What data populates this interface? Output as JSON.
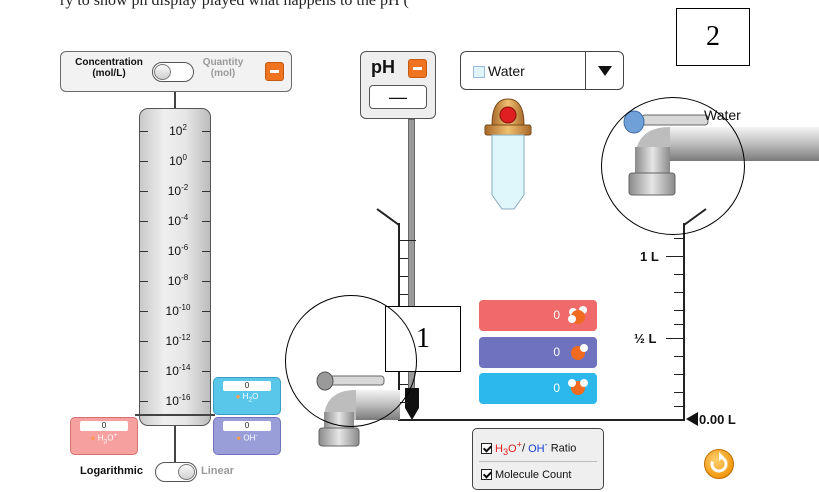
{
  "top_text": "ry to show ph display played what happens to the pH (",
  "callouts": {
    "one": "1",
    "two": "2"
  },
  "concentration_panel": {
    "left_label_line1": "Concentration",
    "left_label_line2": "(mol/L)",
    "right_label_line1": "Quantity",
    "right_label_line2": "(mol)"
  },
  "scale": {
    "labels": [
      {
        "base": "10",
        "exp": "2"
      },
      {
        "base": "10",
        "exp": "0"
      },
      {
        "base": "10",
        "exp": "-2"
      },
      {
        "base": "10",
        "exp": "-4"
      },
      {
        "base": "10",
        "exp": "-6"
      },
      {
        "base": "10",
        "exp": "-8"
      },
      {
        "base": "10",
        "exp": "-10"
      },
      {
        "base": "10",
        "exp": "-12"
      },
      {
        "base": "10",
        "exp": "-14"
      },
      {
        "base": "10",
        "exp": "-16"
      }
    ],
    "toggle_left": "Logarithmic",
    "toggle_right": "Linear"
  },
  "species": {
    "h3o": {
      "value": "0",
      "label_main": "H",
      "label_sub": "3",
      "label_rest": "O",
      "label_sup": "+",
      "color": "#f48080"
    },
    "h2o": {
      "value": "0",
      "label_main": "H",
      "label_sub": "2",
      "label_rest": "O",
      "color": "#59c7ea"
    },
    "oh": {
      "value": "0",
      "label_main": "OH",
      "label_sup": "-",
      "color": "#8a8ed0"
    }
  },
  "ph_meter": {
    "title": "pH",
    "value": "—"
  },
  "solution": {
    "selected": "Water"
  },
  "faucet": {
    "label": "Water"
  },
  "beaker": {
    "mark_1l": "1 L",
    "mark_half": "½ L",
    "volume_readout": "0.00 L"
  },
  "ratio_bars": [
    {
      "value": "0",
      "color": "#f06a6a"
    },
    {
      "value": "0",
      "color": "#6f72bf"
    },
    {
      "value": "0",
      "color": "#2cb8ea"
    }
  ],
  "checkboxes": {
    "ratio_h3o": "H",
    "ratio_h3o_sub": "3",
    "ratio_h3o_rest": "O",
    "ratio_h3o_sup": "+",
    "ratio_sep": "/ ",
    "ratio_oh": "OH",
    "ratio_oh_sup": "-",
    "ratio_word": " Ratio",
    "molecule_count": "Molecule Count"
  },
  "colors": {
    "accent_orange": "#f07320",
    "red": "#e02020",
    "blue": "#1a3fd0"
  }
}
